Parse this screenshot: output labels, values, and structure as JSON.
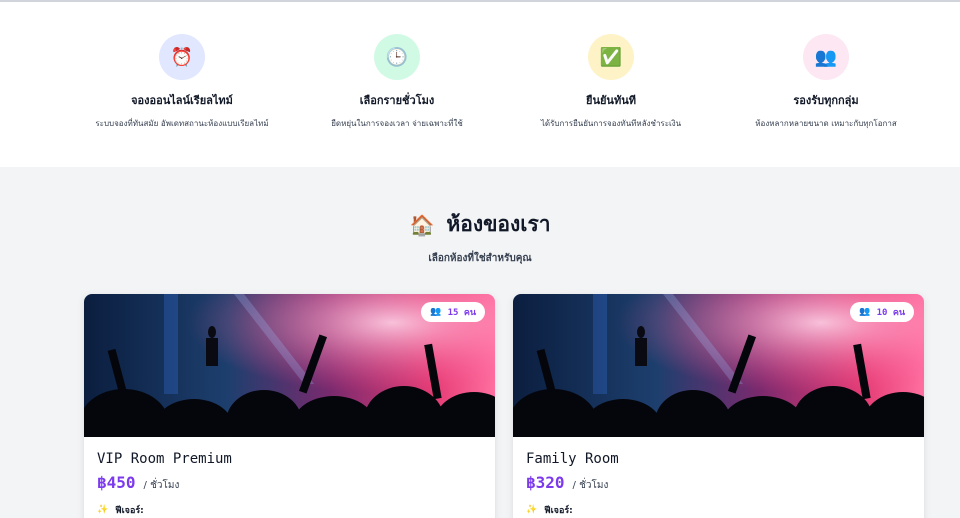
{
  "features": [
    {
      "icon": "alarm-clock-icon",
      "glyph": "⏰",
      "title": "จองออนไลน์เรียลไทม์",
      "desc": "ระบบจองที่ทันสมัย  อัพเดทสถานะห้องแบบเรียลไทม์"
    },
    {
      "icon": "clock-icon",
      "glyph": "🕒",
      "title": "เลือกรายชั่วโมง",
      "desc": "ยืดหยุ่นในการจองเวลา  จ่ายเฉพาะที่ใช้"
    },
    {
      "icon": "check-mark-icon",
      "glyph": "✅",
      "title": "ยืนยันทันที",
      "desc": "ได้รับการยืนยันการจองทันทีหลังชำระเงิน"
    },
    {
      "icon": "users-icon",
      "glyph": "👥",
      "title": "รองรับทุกกลุ่ม",
      "desc": "ห้องหลากหลายขนาด  เหมาะกับทุกโอกาส"
    }
  ],
  "rooms_section": {
    "icon": "house-icon",
    "title": "ห้องของเรา",
    "subtitle": "เลือกห้องที่ใช่สำหรับคุณ"
  },
  "rooms": [
    {
      "name": "VIP Room Premium",
      "price": "฿450",
      "per": "/ ชั่วโมง",
      "capacity": "15 คน",
      "features_label": "ฟีเจอร์:"
    },
    {
      "name": "Family Room",
      "price": "฿320",
      "per": "/ ชั่วโมง",
      "capacity": "10 คน",
      "features_label": "ฟีเจอร์:"
    }
  ],
  "colors": {
    "accent": "#7c3aed",
    "background": "#f3f4f6"
  }
}
